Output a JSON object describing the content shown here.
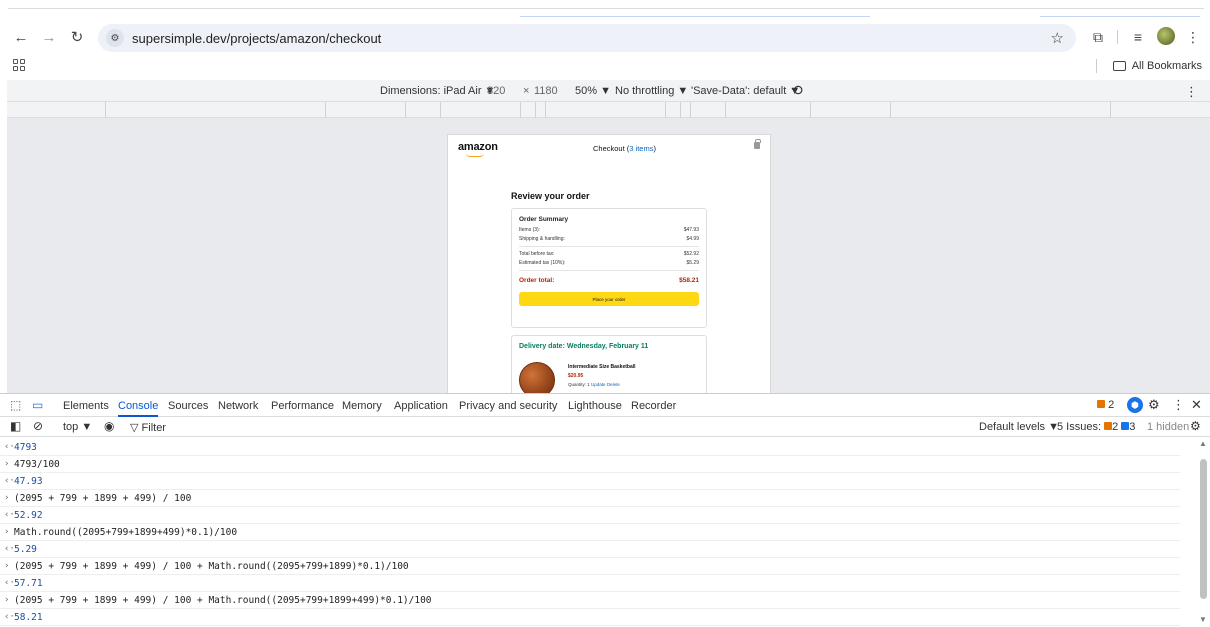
{
  "browser": {
    "url": "supersimple.dev/projects/amazon/checkout",
    "all_bookmarks": "All Bookmarks"
  },
  "device_toolbar": {
    "dimensions": "Dimensions: iPad Air ▼",
    "width": "820",
    "times": "×",
    "height": "1180",
    "zoom": "50% ▼",
    "throttling": "No throttling ▼",
    "save_data": "'Save-Data': default ▼"
  },
  "page": {
    "logo": "amazon",
    "checkout_label": "Checkout (",
    "checkout_items": "3 items",
    "checkout_close": ")",
    "review_title": "Review your order",
    "summary": {
      "title": "Order Summary",
      "items_label": "Items (3):",
      "items_value": "$47.93",
      "shipping_label": "Shipping & handling:",
      "shipping_value": "$4.99",
      "before_tax_label": "Total before tax:",
      "before_tax_value": "$52.92",
      "tax_label": "Estimated tax (10%):",
      "tax_value": "$5.29",
      "total_label": "Order total:",
      "total_value": "$58.21",
      "place_order": "Place your order"
    },
    "delivery": {
      "date": "Delivery date: Wednesday, February 11",
      "product_name": "Intermediate Size Basketball",
      "product_price": "$20.95",
      "quantity": "Quantity: 1",
      "update": "Update",
      "delete": "Delete"
    }
  },
  "devtools": {
    "tabs": [
      "Elements",
      "Console",
      "Sources",
      "Network",
      "Performance",
      "Memory",
      "Application",
      "Privacy and security",
      "Lighthouse",
      "Recorder"
    ],
    "active_tab": "Console",
    "warn_count": "2",
    "context": "top ▼",
    "filter_placeholder": "Filter",
    "default_levels": "Default levels ▼",
    "issues_label": "5 Issues:",
    "issues_warn": "2",
    "issues_info": "3",
    "hidden": "1 hidden"
  },
  "console_lines": [
    {
      "type": "out",
      "text": "4793"
    },
    {
      "type": "in",
      "text": "4793/100"
    },
    {
      "type": "out",
      "text": "47.93"
    },
    {
      "type": "in",
      "text": "(2095 + 799 + 1899 + 499) / 100"
    },
    {
      "type": "out",
      "text": "52.92"
    },
    {
      "type": "in",
      "text": "Math.round((2095+799+1899+499)*0.1)/100"
    },
    {
      "type": "out",
      "text": "5.29"
    },
    {
      "type": "in",
      "text": "(2095 + 799 + 1899 + 499) / 100 + Math.round((2095+799+1899)*0.1)/100"
    },
    {
      "type": "out",
      "text": "57.71"
    },
    {
      "type": "in",
      "text": "(2095 + 799 + 1899 + 499) / 100 + Math.round((2095+799+1899+499)*0.1)/100"
    },
    {
      "type": "out",
      "text": "58.21"
    }
  ]
}
